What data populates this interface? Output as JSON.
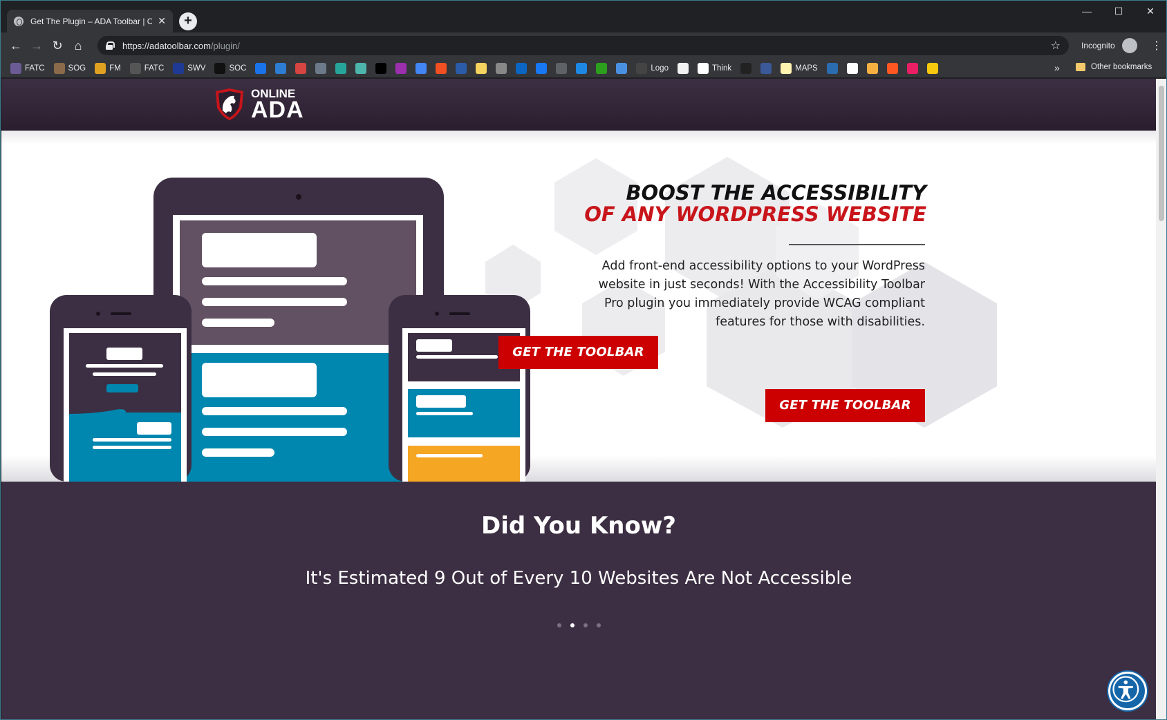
{
  "browser": {
    "tab_title": "Get The Plugin – ADA Toolbar | O",
    "new_tab_label": "+",
    "window_controls": {
      "minimize": "—",
      "maximize": "☐",
      "close": "✕"
    },
    "url_host": "https://adatoolbar.com",
    "url_path": "/plugin/",
    "incognito_label": "Incognito",
    "bookmarks": [
      {
        "label": "FATC",
        "icon": "fatc-icon",
        "color": "#6b5b95"
      },
      {
        "label": "SOG",
        "icon": "sog-icon",
        "color": "#8a6a4a"
      },
      {
        "label": "FM",
        "icon": "lightning-icon",
        "color": "#e0a020"
      },
      {
        "label": "FATC",
        "icon": "fatc-m-icon",
        "color": "#555555"
      },
      {
        "label": "SWV",
        "icon": "bl-icon",
        "color": "#1f3a93"
      },
      {
        "label": "SOC",
        "icon": "g-icon",
        "color": "#111111"
      },
      {
        "label": "",
        "icon": "calendar-icon",
        "color": "#1a73e8"
      },
      {
        "label": "",
        "icon": "gb-icon",
        "color": "#2d7dd2"
      },
      {
        "label": "",
        "icon": "graduation-icon",
        "color": "#d64541"
      },
      {
        "label": "",
        "icon": "grid-icon",
        "color": "#6c7a89"
      },
      {
        "label": "",
        "icon": "cloud-icon",
        "color": "#26a69a"
      },
      {
        "label": "",
        "icon": "cloud2-icon",
        "color": "#4db6ac"
      },
      {
        "label": "",
        "icon": "arrow-icon",
        "color": "#000000"
      },
      {
        "label": "",
        "icon": "p-icon",
        "color": "#9b2fae"
      },
      {
        "label": "",
        "icon": "ads-icon",
        "color": "#4285f4"
      },
      {
        "label": "",
        "icon": "microsoft-icon",
        "color": "#f25022"
      },
      {
        "label": "",
        "icon": "chevron-icon",
        "color": "#2a5caa"
      },
      {
        "label": "",
        "icon": "note-icon",
        "color": "#f4d35e"
      },
      {
        "label": "",
        "icon": "page-icon",
        "color": "#888888"
      },
      {
        "label": "",
        "icon": "linkedin-icon",
        "color": "#0a66c2"
      },
      {
        "label": "",
        "icon": "facebook-icon",
        "color": "#1877f2"
      },
      {
        "label": "",
        "icon": "doc-icon",
        "color": "#5f6368"
      },
      {
        "label": "",
        "icon": "camera-icon",
        "color": "#1e88e5"
      },
      {
        "label": "",
        "icon": "qb-icon",
        "color": "#2ca01c"
      },
      {
        "label": "",
        "icon": "wifi-icon",
        "color": "#4a90e2"
      },
      {
        "label": "Logo",
        "icon": "ew-icon",
        "color": "#444444"
      },
      {
        "label": "",
        "icon": "amazon-icon",
        "color": "#f2f2f2"
      },
      {
        "label": "Think",
        "icon": "google-icon",
        "color": "#ffffff"
      },
      {
        "label": "",
        "icon": "cl-icon",
        "color": "#222222"
      },
      {
        "label": "",
        "icon": "circle-check-icon",
        "color": "#3b5998"
      },
      {
        "label": "MAPS",
        "icon": "maps-note-icon",
        "color": "#fff3b0"
      },
      {
        "label": "",
        "icon": "sd-icon",
        "color": "#2b6cb0"
      },
      {
        "label": "",
        "icon": "s-icon",
        "color": "#ffffff"
      },
      {
        "label": "",
        "icon": "sg-icon",
        "color": "#f5b041"
      },
      {
        "label": "",
        "icon": "blogger-icon",
        "color": "#ff5722"
      },
      {
        "label": "",
        "icon": "bug-icon",
        "color": "#e91e63"
      },
      {
        "label": "",
        "icon": "music-icon",
        "color": "#f6c90e"
      }
    ],
    "bookmarks_more": "»",
    "other_bookmarks": "Other bookmarks"
  },
  "site": {
    "logo_online": "ONLINE",
    "logo_ada": "ADA",
    "hero": {
      "title_line1": "BOOST THE ACCESSIBILITY",
      "title_line2": "OF ANY WORDPRESS WEBSITE",
      "description": "Add front-end accessibility options to your WordPress website in just seconds! With the Accessibility Toolbar Pro plugin you immediately provide WCAG compliant features for those with disabilities.",
      "cta": "GET THE TOOLBAR"
    },
    "did_you_know": {
      "title": "Did You Know?",
      "fact": "It's Estimated 9 Out of Every 10 Websites Are Not Accessible",
      "slides": 4,
      "active_slide": 2,
      "cta": "GET THE TOOLBAR"
    }
  },
  "colors": {
    "brand_purple": "#3d2f43",
    "brand_red": "#cc0000",
    "device_teal": "#0087b0",
    "device_orange": "#f5a623"
  }
}
